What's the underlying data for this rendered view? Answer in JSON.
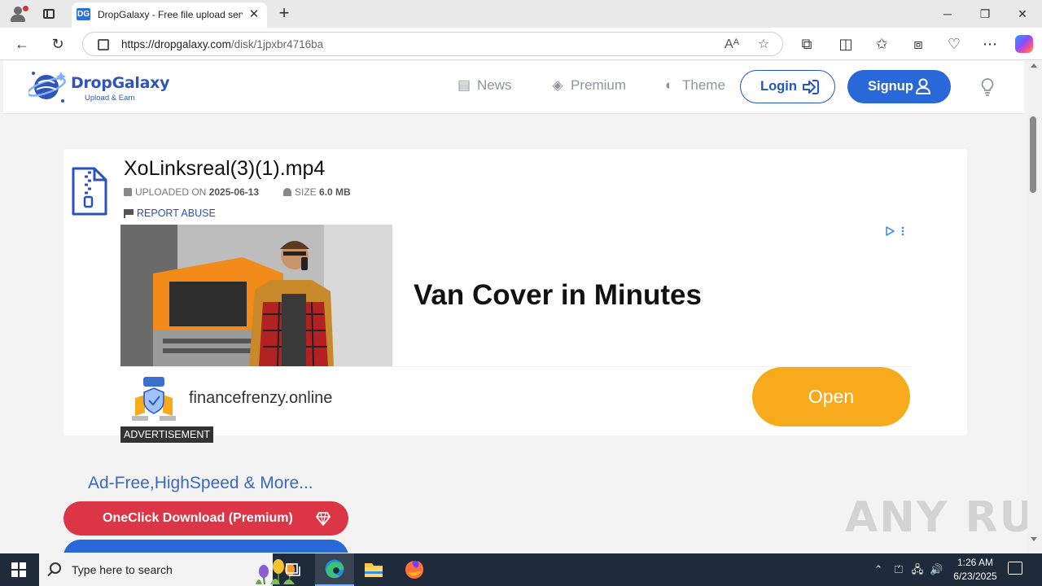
{
  "browser": {
    "tab_title": "DropGalaxy - Free file upload service",
    "tab_favicon": "DG",
    "url_domain": "https://dropgalaxy.com",
    "url_path": "/disk/1jpxbr4716ba",
    "icons": [
      "profile-icon",
      "tabs-icon",
      "close-icon",
      "plus-icon",
      "back-icon",
      "refresh-icon",
      "lock-icon",
      "read-aloud-icon",
      "favorite-star-icon",
      "extensions-icon",
      "split-screen-icon",
      "favorites-icon",
      "collections-icon",
      "browser-essentials-icon",
      "more-icon",
      "copilot-icon"
    ]
  },
  "site": {
    "logo_name": "DropGalaxy",
    "logo_tagline": "Upload & Earn",
    "nav": {
      "news": "News",
      "premium": "Premium",
      "theme": "Theme",
      "login": "Login",
      "signup": "Signup"
    }
  },
  "file": {
    "name": "XoLinksreal(3)(1).mp4",
    "uploaded_label": "UPLOADED ON",
    "uploaded_date": "2025-06-13",
    "size_label": "SIZE",
    "size_value": "6.0 MB",
    "report": "REPORT ABUSE"
  },
  "ad": {
    "headline": "Van Cover in Minutes",
    "domain": "financefrenzy.online",
    "cta": "Open",
    "label": "ADVERTISEMENT"
  },
  "promo": {
    "heading": "Ad-Free,HighSpeed & More...",
    "premium_button": "OneClick Download (Premium)"
  },
  "watermark": "ANY RUN",
  "taskbar": {
    "search_placeholder": "Type here to search",
    "time": "1:26 AM",
    "date": "6/23/2025"
  },
  "colors": {
    "brand_blue": "#2868d8",
    "premium_red": "#dc3545",
    "ad_orange": "#f7aa1c"
  }
}
